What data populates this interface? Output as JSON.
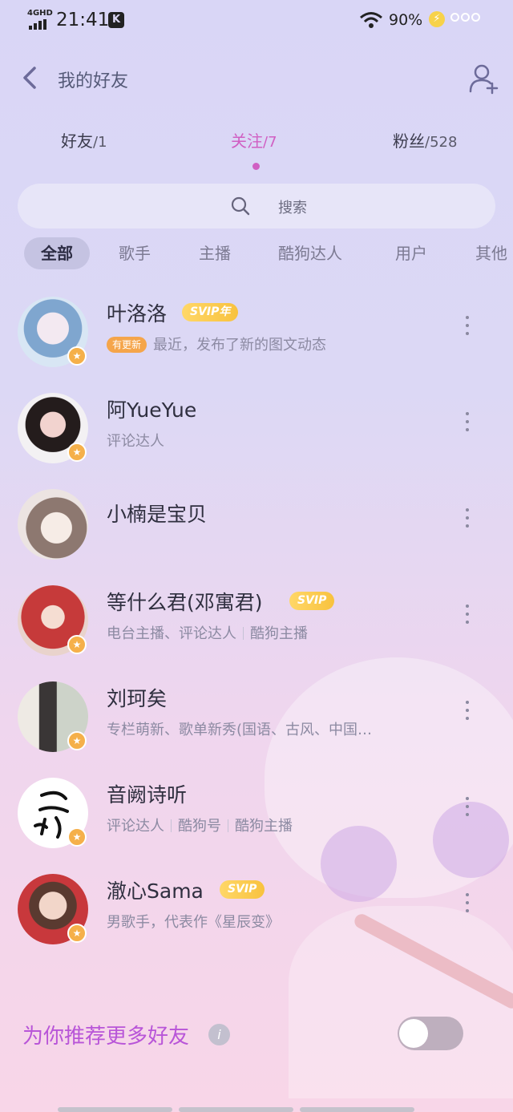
{
  "status_bar": {
    "network": "4GHD",
    "time": "21:41",
    "app_badge": "K",
    "battery": "90%"
  },
  "header": {
    "title": "我的好友"
  },
  "tabs": [
    {
      "label": "好友",
      "count": "/1"
    },
    {
      "label": "关注",
      "count": "/7",
      "active": true
    },
    {
      "label": "粉丝",
      "count": "/528"
    }
  ],
  "search": {
    "placeholder": "搜索"
  },
  "filters": [
    "全部",
    "歌手",
    "主播",
    "酷狗达人",
    "用户",
    "其他"
  ],
  "friends": [
    {
      "name": "叶洛洛",
      "vip": "SVIP年",
      "update_badge": "有更新",
      "subtitle": "最近，发布了新的图文动态",
      "tags": []
    },
    {
      "name": "阿YueYue",
      "vip": "",
      "subtitle": "",
      "tags": [
        "评论达人"
      ]
    },
    {
      "name": "小楠是宝贝",
      "vip": "",
      "subtitle": "",
      "tags": []
    },
    {
      "name": "等什么君(邓寓君)",
      "vip": "SVIP",
      "subtitle": "",
      "tags": [
        "电台主播、评论达人",
        "酷狗主播"
      ]
    },
    {
      "name": "刘珂矣",
      "vip": "",
      "subtitle": "",
      "tags": [
        "专栏萌新、歌单新秀(国语、古风、中国…"
      ]
    },
    {
      "name": "音阙诗听",
      "vip": "",
      "subtitle": "",
      "tags": [
        "评论达人",
        "酷狗号",
        "酷狗主播"
      ]
    },
    {
      "name": "澈心Sama",
      "vip": "SVIP",
      "subtitle": "",
      "tags": [
        "男歌手，代表作《星辰变》"
      ]
    }
  ],
  "recommend": {
    "label": "为你推荐更多好友",
    "info": "i",
    "enabled": false
  },
  "colors": {
    "accent": "#d05fc3",
    "recommend": "#b855d8",
    "vip_gold": "#f8c23e",
    "update_orange": "#f5a54a"
  }
}
